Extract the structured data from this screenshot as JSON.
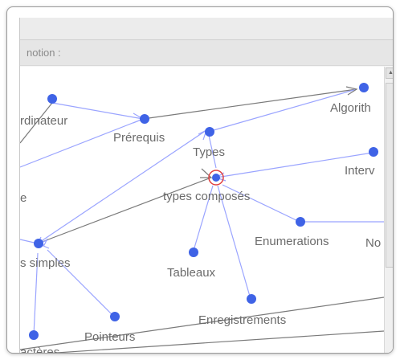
{
  "panel": {
    "label": "notion :"
  },
  "graph": {
    "nodes": [
      {
        "id": "ordinateur",
        "label": "rdinateur"
      },
      {
        "id": "prerequis",
        "label": "Prérequis"
      },
      {
        "id": "types",
        "label": "Types"
      },
      {
        "id": "algorithme",
        "label": "Algorith"
      },
      {
        "id": "intervalles",
        "label": "Interv"
      },
      {
        "id": "e",
        "label": "e"
      },
      {
        "id": "types-composes",
        "label": "types composés"
      },
      {
        "id": "enumerations",
        "label": "Enumerations"
      },
      {
        "id": "no",
        "label": "No"
      },
      {
        "id": "types-simples",
        "label": "s simples"
      },
      {
        "id": "tableaux",
        "label": "Tableaux"
      },
      {
        "id": "enregistrements",
        "label": "Enregistrements"
      },
      {
        "id": "pointeurs",
        "label": "Pointeurs"
      },
      {
        "id": "caracteres",
        "label": "actères"
      }
    ]
  },
  "colors": {
    "node": "#3f63e6",
    "edge_blue": "#9aa4ff",
    "edge_gray": "#7a7a7a",
    "selected_ring": "#e04040",
    "label": "#6b6b6b"
  }
}
